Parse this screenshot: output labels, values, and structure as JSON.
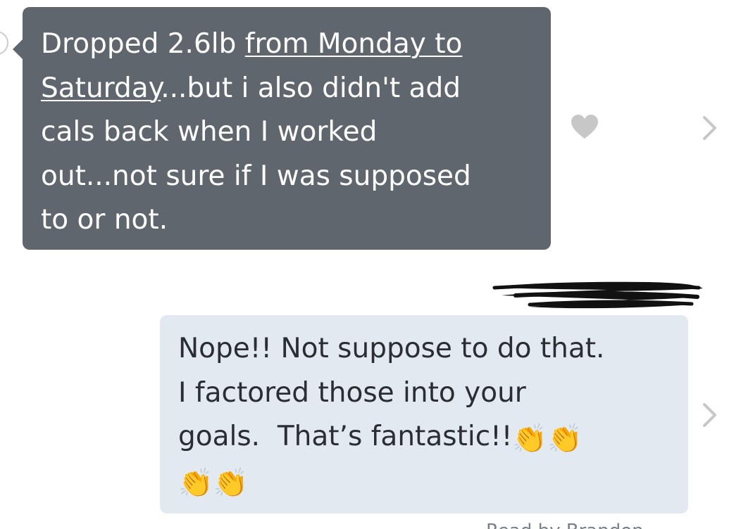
{
  "messages": [
    {
      "direction": "incoming",
      "text_before": "Dropped 2.6lb ",
      "text_link": "from Monday to\nSaturday",
      "text_after": "...but i also didn't add\ncals back when I worked\nout...not sure if I was supposed\nto or not.",
      "liked": false
    },
    {
      "direction": "outgoing",
      "text": "Nope!! Not suppose to do that.\nI factored those into your\ngoals.  That’s fantastic!!",
      "emoji": [
        "👏",
        "👏",
        "👏",
        "👏"
      ]
    }
  ],
  "footer": {
    "read_receipt": "Read by Brandon"
  },
  "colors": {
    "incoming_bubble": "#5f666d",
    "outgoing_bubble": "#e3e9f1",
    "icon_gray": "#c7c7c7"
  },
  "icons": {
    "like": "heart-icon",
    "details": "chevron-right-icon"
  }
}
